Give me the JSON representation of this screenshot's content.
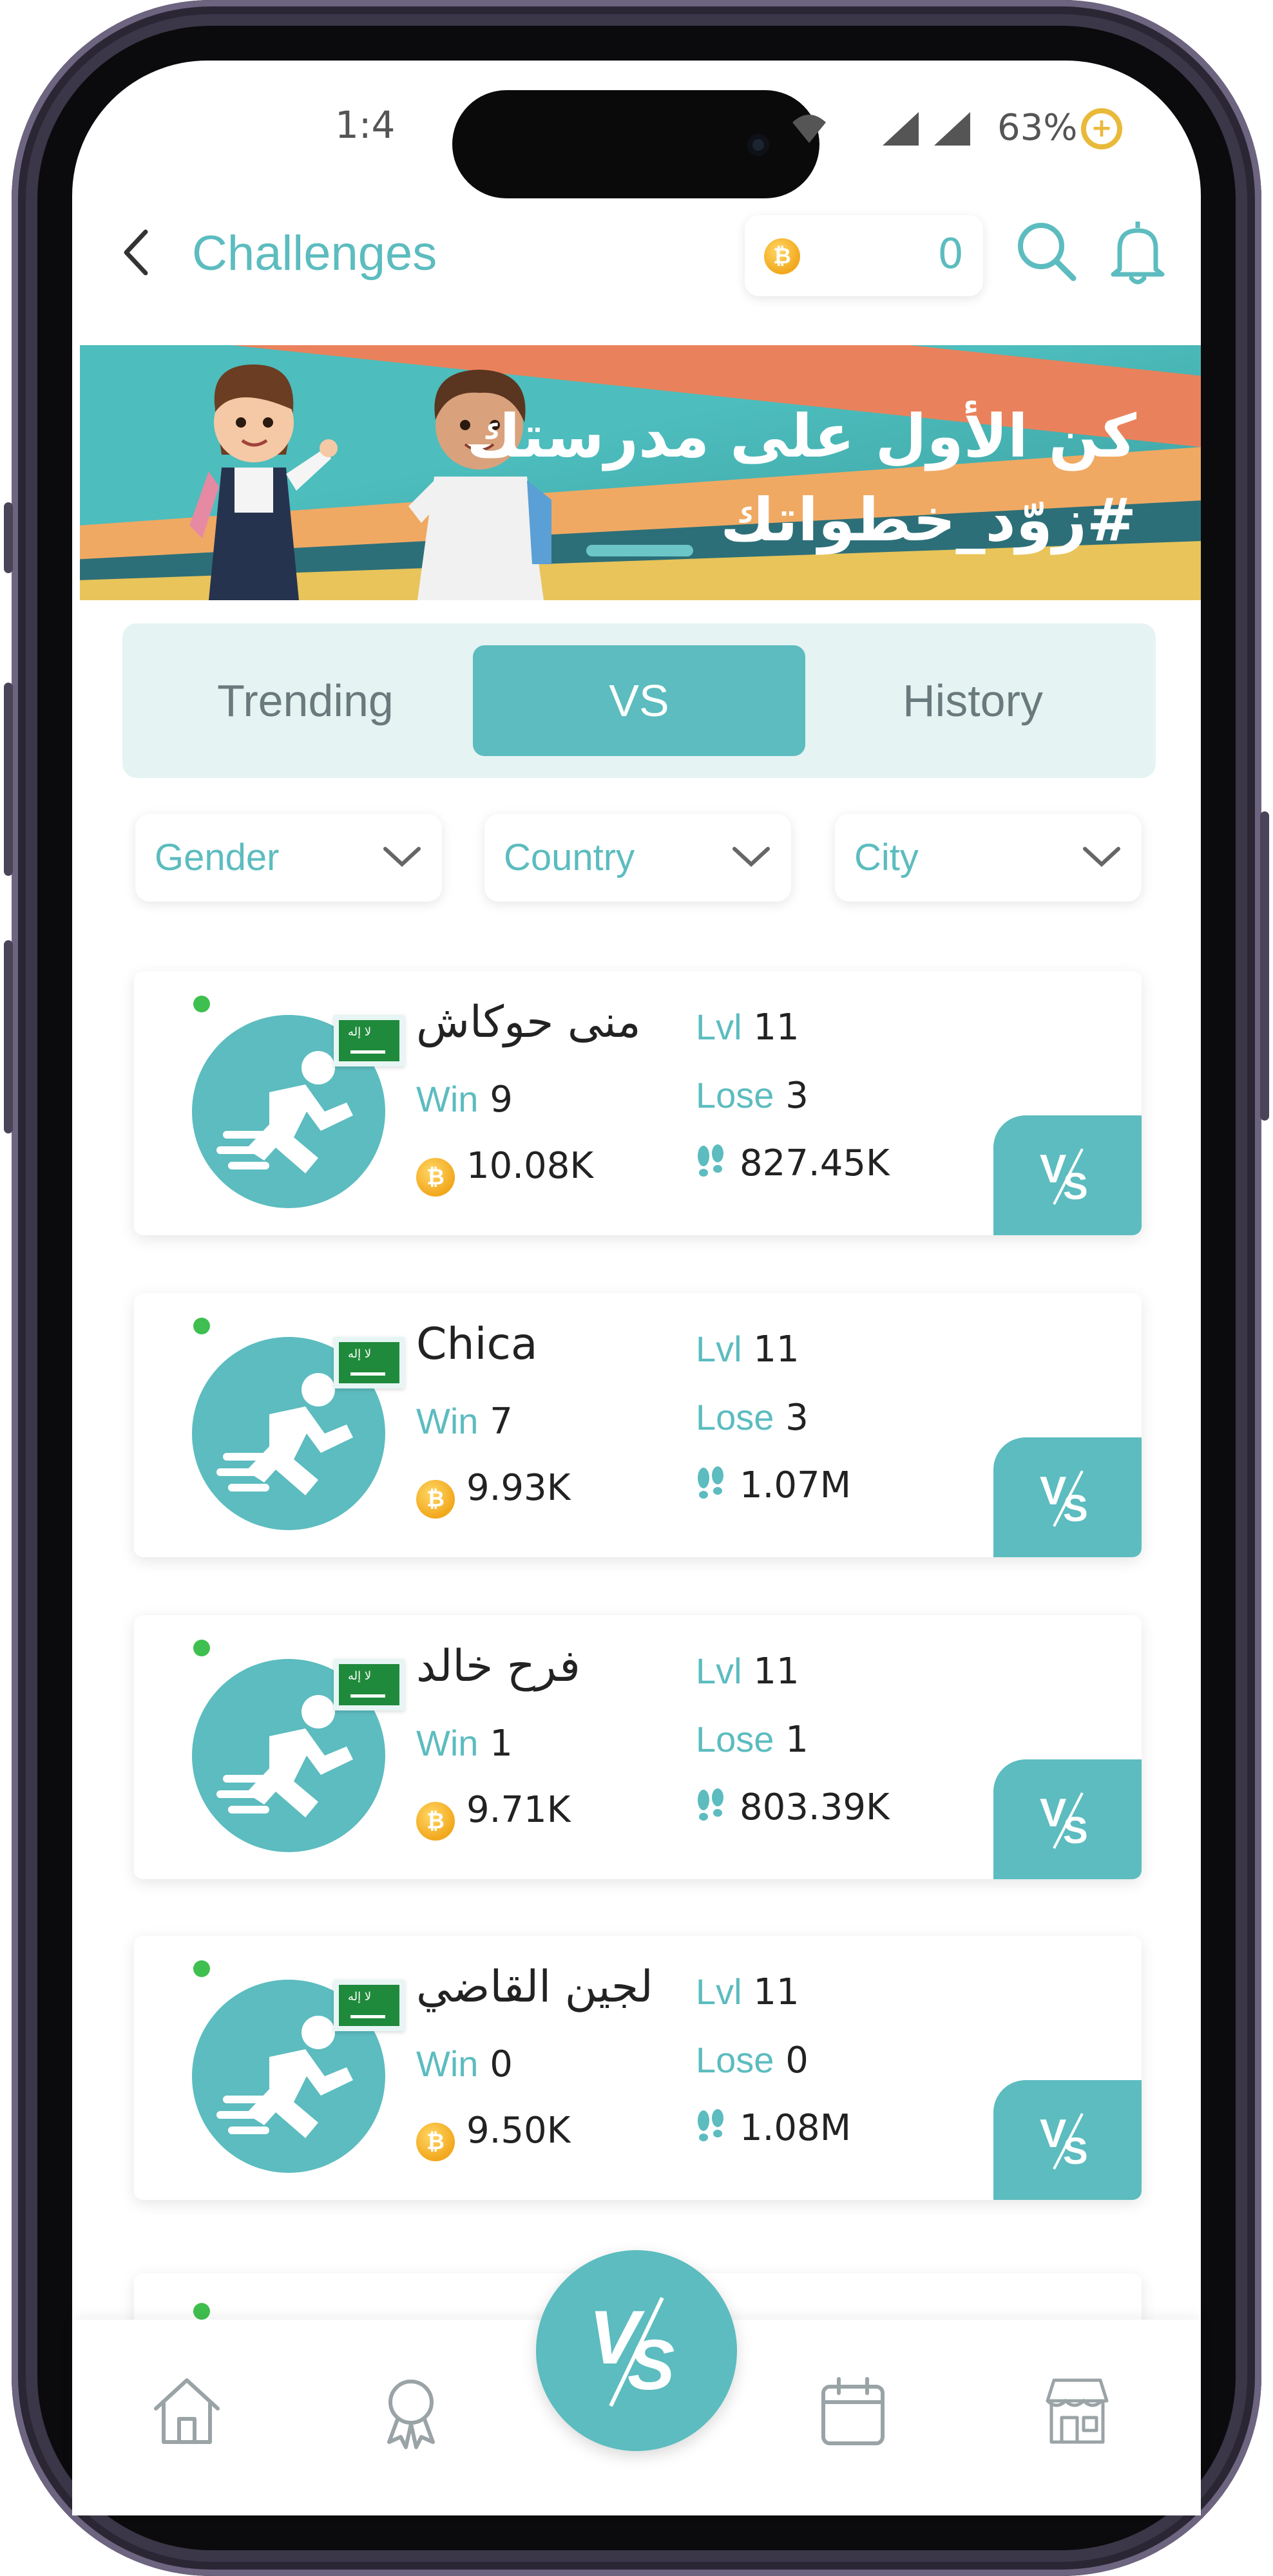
{
  "status_bar": {
    "time": "1:4",
    "battery": "63%",
    "battery_plus": "+"
  },
  "header": {
    "title": "Challenges",
    "coin_balance": "0",
    "coin_symbol": "₿"
  },
  "banner": {
    "line1": "كن الأول على مدرستك",
    "line2": "#زوّد_خطواتك"
  },
  "tabs": [
    {
      "label": "Trending",
      "active": false
    },
    {
      "label": "VS",
      "active": true
    },
    {
      "label": "History",
      "active": false
    }
  ],
  "filters": [
    {
      "label": "Gender"
    },
    {
      "label": "Country"
    },
    {
      "label": "City"
    }
  ],
  "labels": {
    "win": "Win",
    "lose": "Lose",
    "lvl": "Lvl",
    "vs": "VS",
    "flag_text": "لا إله"
  },
  "players": [
    {
      "name": "منى حوكاش",
      "level": "11",
      "wins": "9",
      "losses": "3",
      "coins": "10.08K",
      "steps": "827.45K"
    },
    {
      "name": "Chica",
      "level": "11",
      "wins": "7",
      "losses": "3",
      "coins": "9.93K",
      "steps": "1.07M"
    },
    {
      "name": "فرح خالد",
      "level": "11",
      "wins": "1",
      "losses": "1",
      "coins": "9.71K",
      "steps": "803.39K"
    },
    {
      "name": "لجين القاضي",
      "level": "11",
      "wins": "0",
      "losses": "0",
      "coins": "9.50K",
      "steps": "1.08M"
    }
  ],
  "bottom_nav": [
    {
      "icon": "home-icon"
    },
    {
      "icon": "award-icon"
    },
    {
      "icon": "vs-icon"
    },
    {
      "icon": "calendar-icon"
    },
    {
      "icon": "store-icon"
    }
  ],
  "colors": {
    "accent": "#5cbcbf",
    "tab_bg": "#e5f3f3",
    "online": "#3fbf4f",
    "coin": "#f2a81d"
  }
}
